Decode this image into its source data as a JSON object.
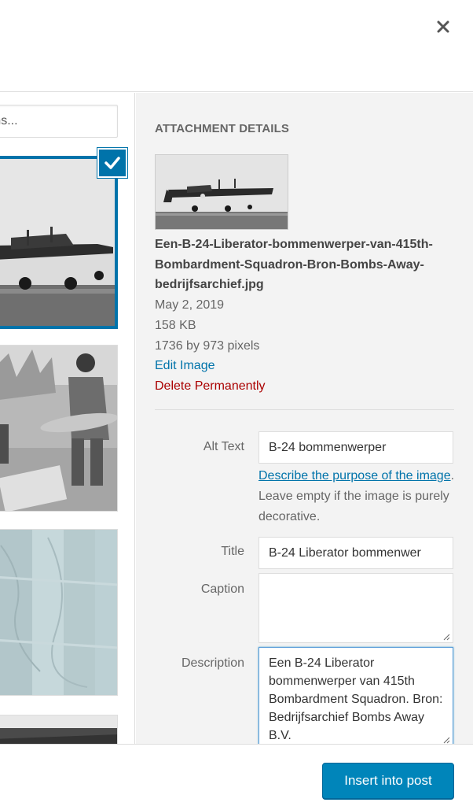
{
  "modal": {
    "close_icon": "close-icon"
  },
  "library": {
    "search_placeholder": "items...",
    "items": [
      {
        "name": "B-24 Liberator photo",
        "selected": true
      },
      {
        "name": "Soldier with bomb photo",
        "selected": false
      },
      {
        "name": "Map photo",
        "selected": false
      },
      {
        "name": "Dark photo",
        "selected": false
      }
    ]
  },
  "details": {
    "heading": "ATTACHMENT DETAILS",
    "filename": "Een-B-24-Liberator-bommenwerper-van-415th-Bombardment-Squadron-Bron-Bombs-Away-bedrijfsarchief.jpg",
    "date": "May 2, 2019",
    "size": "158 KB",
    "dimensions": "1736 by 973 pixels",
    "edit_link": "Edit Image",
    "delete_link": "Delete Permanently",
    "colors": {
      "link": "#0073aa",
      "delete": "#a00000",
      "primary_button": "#0085ba"
    }
  },
  "form": {
    "alt_label": "Alt Text",
    "alt_value": "B-24 bommenwerper",
    "alt_help_link": "Describe the purpose of the image",
    "alt_help_text": ". Leave empty if the image is purely decorative.",
    "title_label": "Title",
    "title_value": "B-24 Liberator bommenwer",
    "caption_label": "Caption",
    "caption_value": "",
    "description_label": "Description",
    "description_value": "Een B-24 Liberator bommenwerper van 415th Bombardment Squadron. Bron: Bedrijfsarchief Bombs Away B.V."
  },
  "footer": {
    "insert_button": "Insert into post"
  }
}
